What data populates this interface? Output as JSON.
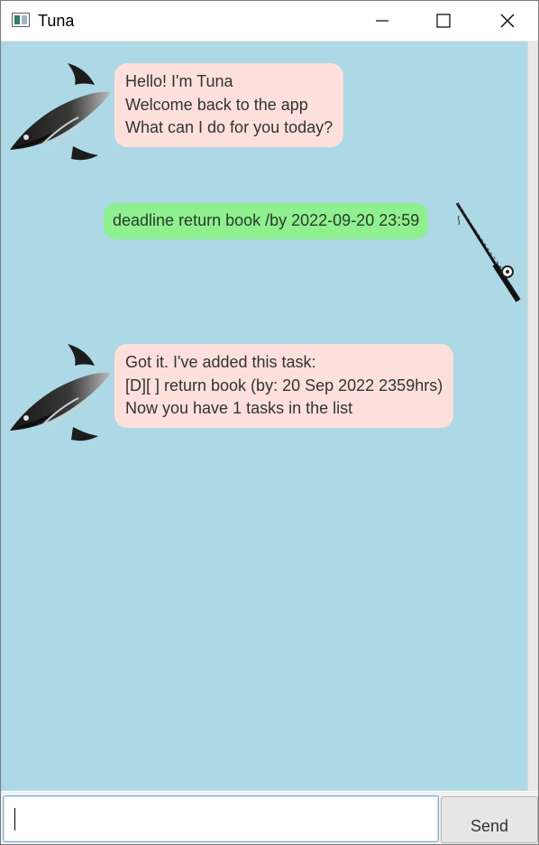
{
  "window": {
    "title": "Tuna",
    "icons": {
      "app": "app-window-icon",
      "minimize": "minimize-icon",
      "maximize": "maximize-icon",
      "close": "close-icon"
    }
  },
  "colors": {
    "chat_background": "#add8e6",
    "bot_bubble": "#fde0dc",
    "user_bubble": "#8ef08e"
  },
  "messages": [
    {
      "sender": "bot",
      "avatar": "tuna-fish-icon",
      "lines": [
        "Hello! I'm Tuna",
        "Welcome back to the app",
        "What can I do for you today?"
      ]
    },
    {
      "sender": "user",
      "avatar": "fishing-rod-icon",
      "lines": [
        "deadline return book /by 2022-09-20 23:59"
      ]
    },
    {
      "sender": "bot",
      "avatar": "tuna-fish-icon",
      "lines": [
        "Got it. I've added this task:",
        "[D][ ] return book (by: 20 Sep 2022 2359hrs)",
        "Now you have 1 tasks in the list"
      ]
    }
  ],
  "input": {
    "value": "",
    "placeholder": ""
  },
  "send_button": {
    "label": "Send"
  }
}
